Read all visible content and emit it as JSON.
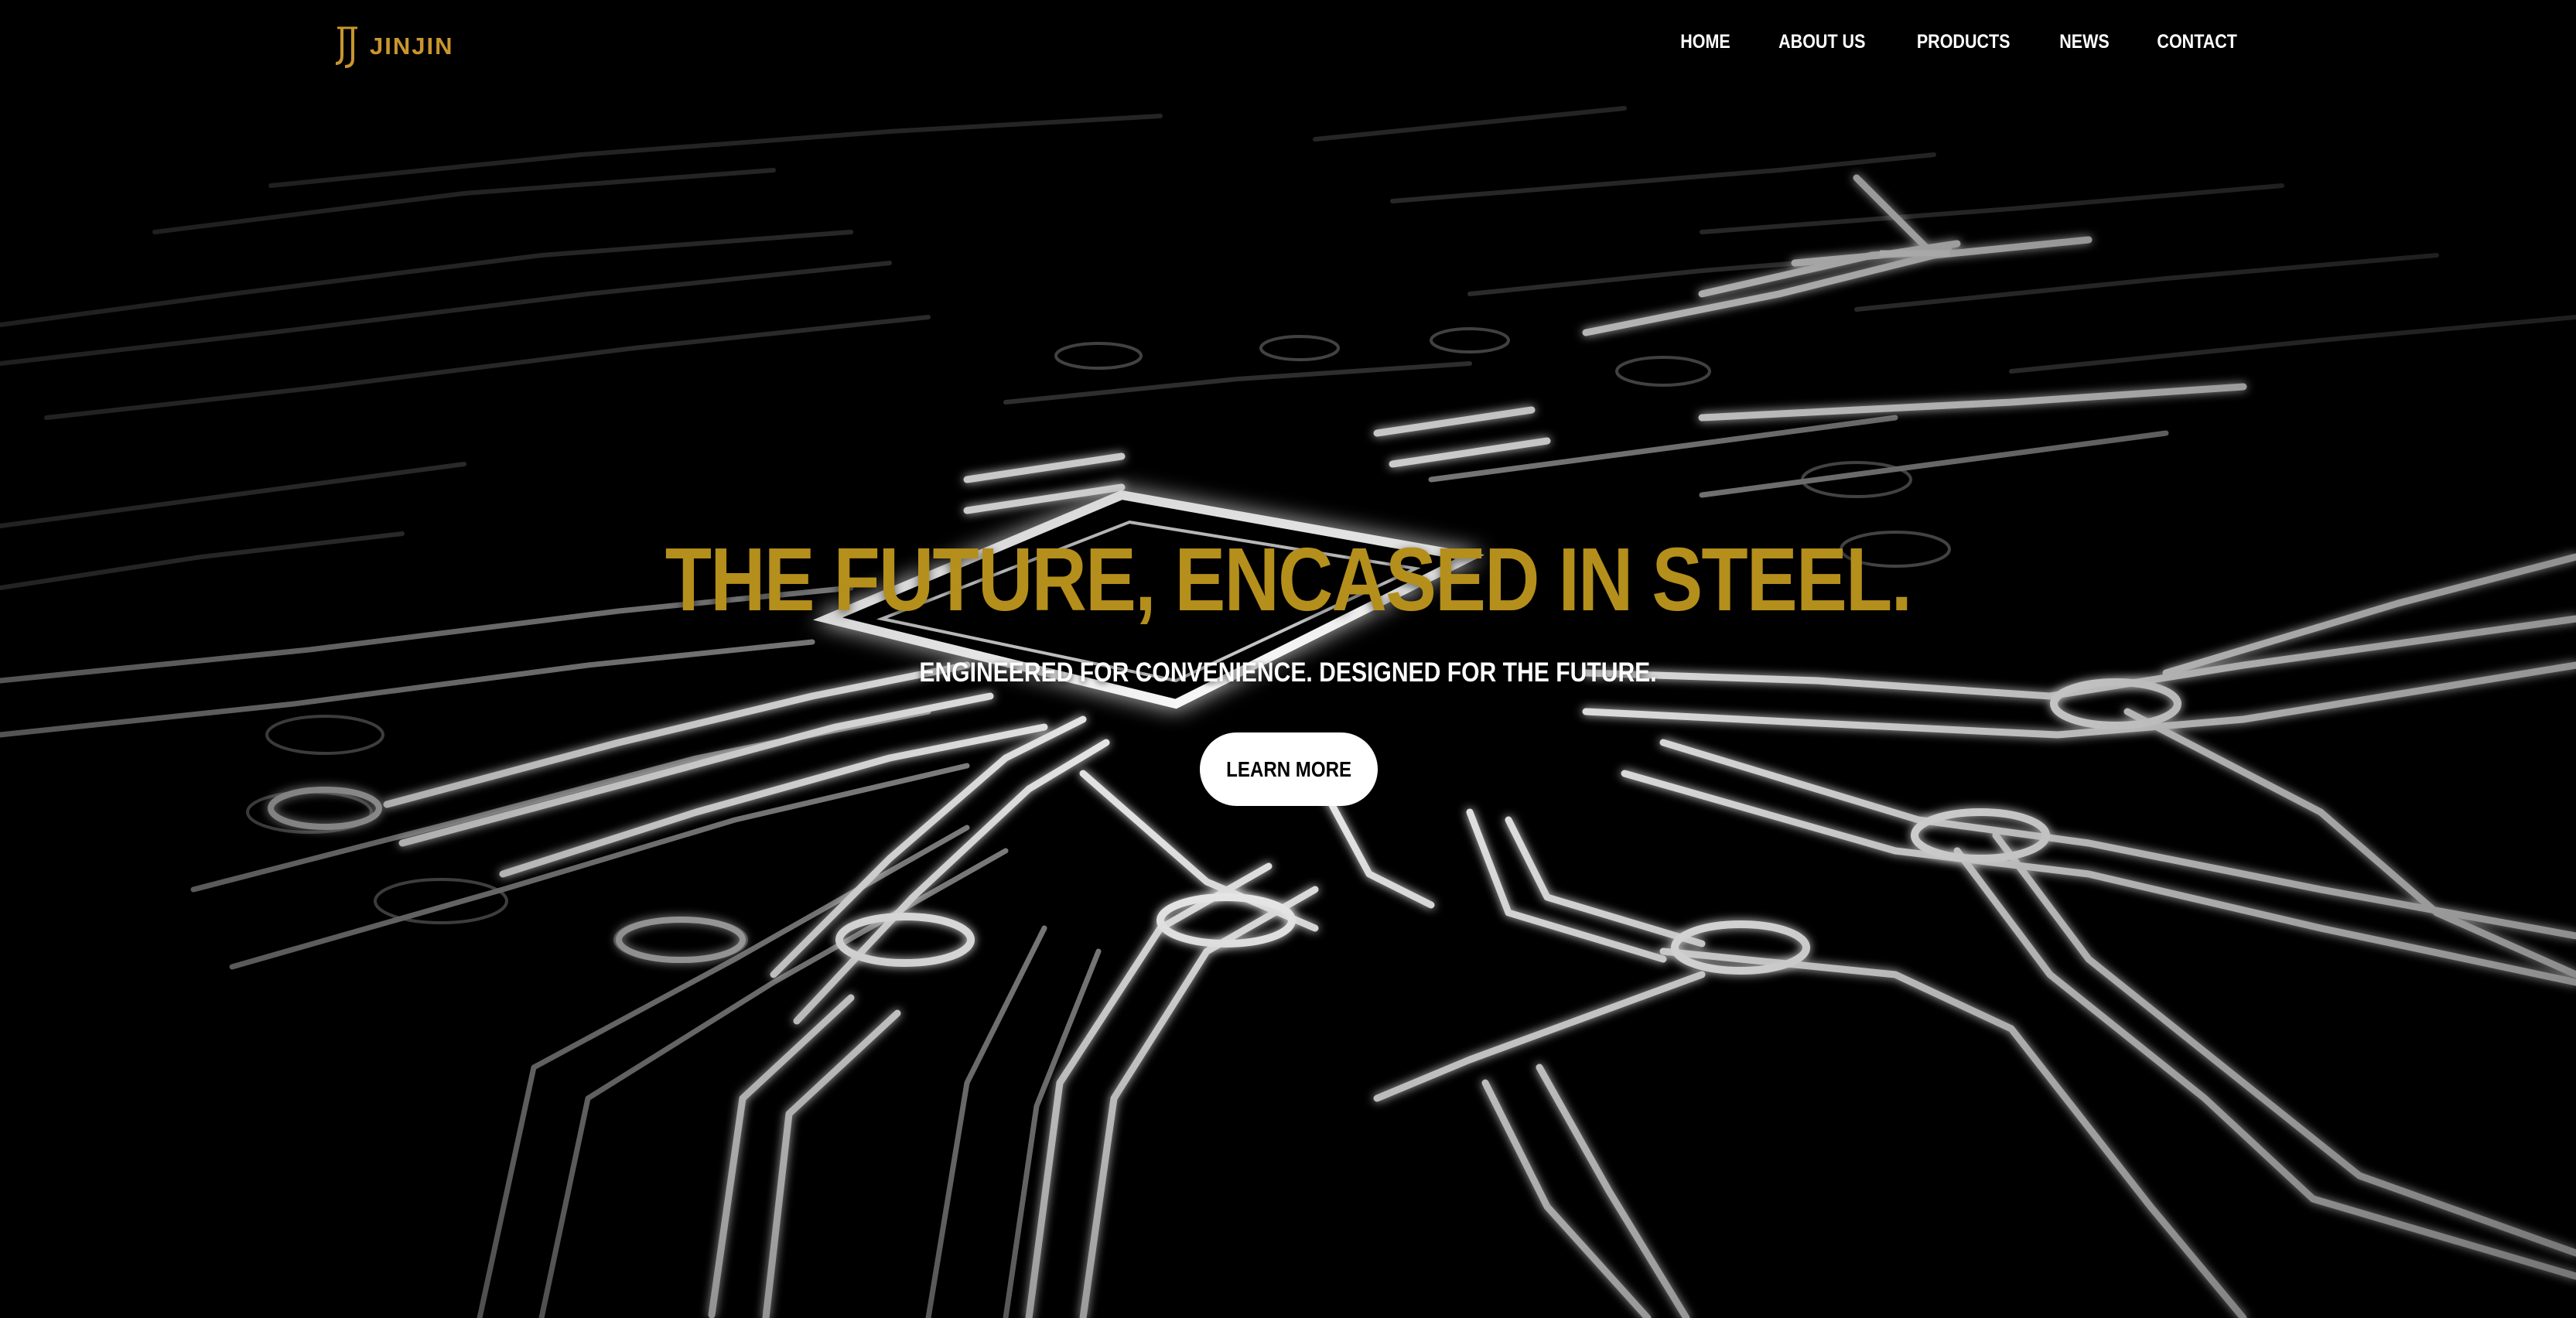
{
  "header": {
    "logo_text": "JINJIN",
    "logo_icon": "jj-monogram-icon",
    "nav": [
      {
        "label": "HOME"
      },
      {
        "label": "ABOUT US"
      },
      {
        "label": "PRODUCTS"
      },
      {
        "label": "NEWS"
      },
      {
        "label": "CONTACT"
      }
    ]
  },
  "hero": {
    "title": "THE FUTURE, ENCASED IN STEEL.",
    "subtitle": "ENGINEERED FOR CONVENIENCE. DESIGNED FOR THE FUTURE.",
    "cta_label": "LEARN MORE",
    "background": "circuit-board-image"
  },
  "colors": {
    "background": "#000000",
    "accent_gold": "#b58f1c",
    "logo_gold": "#c9962e",
    "text_white": "#ffffff"
  }
}
